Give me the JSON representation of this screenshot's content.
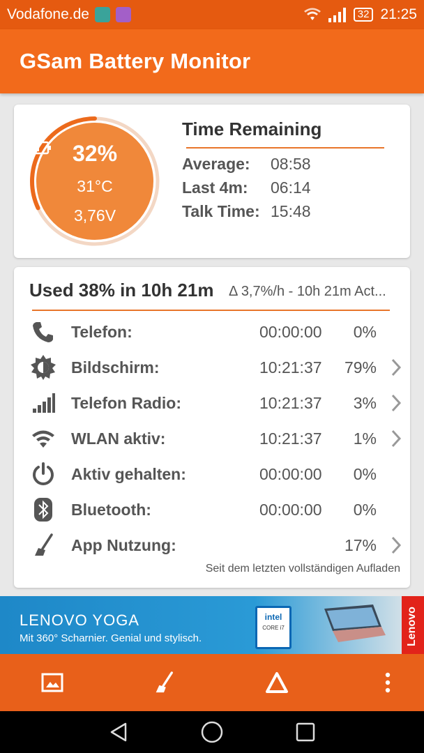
{
  "status_bar": {
    "carrier": "Vodafone.de",
    "battery": "32",
    "time": "21:25"
  },
  "app": {
    "title": "GSam Battery Monitor"
  },
  "gauge": {
    "percent": "32%",
    "temperature": "31°C",
    "voltage": "3,76V",
    "level": 0.32
  },
  "time_remaining": {
    "title": "Time Remaining",
    "rows": [
      {
        "label": "Average:",
        "value": "08:58"
      },
      {
        "label": "Last 4m:",
        "value": "06:14"
      },
      {
        "label": "Talk Time:",
        "value": "15:48"
      }
    ]
  },
  "usage": {
    "title": "Used 38% in 10h 21m",
    "subtitle": "Δ 3,7%/h - 10h 21m Act...",
    "rows": [
      {
        "icon": "phone-icon",
        "label": "Telefon:",
        "time": "00:00:00",
        "percent": "0%",
        "chevron": false
      },
      {
        "icon": "brightness-icon",
        "label": "Bildschirm:",
        "time": "10:21:37",
        "percent": "79%",
        "chevron": true
      },
      {
        "icon": "signal-bars-icon",
        "label": "Telefon Radio:",
        "time": "10:21:37",
        "percent": "3%",
        "chevron": true
      },
      {
        "icon": "wifi-icon",
        "label": "WLAN aktiv:",
        "time": "10:21:37",
        "percent": "1%",
        "chevron": true
      },
      {
        "icon": "power-icon",
        "label": "Aktiv gehalten:",
        "time": "00:00:00",
        "percent": "0%",
        "chevron": false
      },
      {
        "icon": "bluetooth-icon",
        "label": "Bluetooth:",
        "time": "00:00:00",
        "percent": "0%",
        "chevron": false
      },
      {
        "icon": "broom-icon",
        "label": "App Nutzung:",
        "time": "",
        "percent": "17%",
        "chevron": true
      }
    ],
    "footnote": "Seit dem letzten vollständigen Aufladen"
  },
  "ad": {
    "brand": "LENOVO YOGA",
    "tagline": "Mit 360° Scharnier. Genial und stylisch.",
    "badge_brand": "intel",
    "badge_model": "CORE i7",
    "side_brand": "Lenovo"
  },
  "bottom_bar": {
    "icons": [
      "image-icon",
      "broom-icon",
      "delta-icon",
      "more-vert-icon"
    ]
  },
  "nav_bar": {
    "icons": [
      "back-icon",
      "home-icon",
      "recents-icon"
    ]
  },
  "colors": {
    "status_bar": "#e55a10",
    "app_bar": "#f26a1b",
    "gauge": "#f0883a",
    "accent_line": "#e8752a",
    "bottom_bar": "#e8601a"
  }
}
